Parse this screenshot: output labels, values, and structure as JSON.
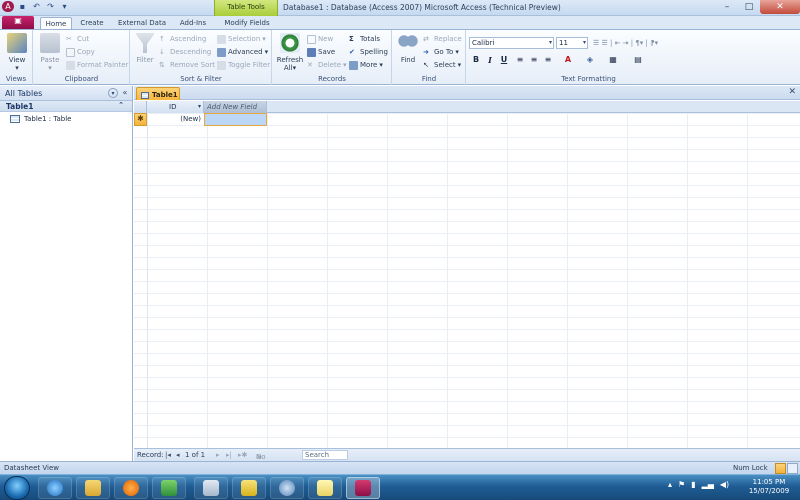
{
  "window": {
    "title": "Database1 : Database (Access 2007)    Microsoft Access (Technical Preview)",
    "context_tab_header": "Table Tools"
  },
  "ribbon_tabs": [
    {
      "label": "Home",
      "active": true
    },
    {
      "label": "Create",
      "active": false
    },
    {
      "label": "External Data",
      "active": false
    },
    {
      "label": "Add-Ins",
      "active": false
    },
    {
      "label": "Modify Fields",
      "active": false
    }
  ],
  "groups": {
    "views": {
      "label": "Views",
      "view_button": "View"
    },
    "clipboard": {
      "label": "Clipboard",
      "paste": "Paste",
      "cut": "Cut",
      "copy": "Copy",
      "format_painter": "Format Painter"
    },
    "sort_filter": {
      "label": "Sort & Filter",
      "filter": "Filter",
      "ascending": "Ascending",
      "descending": "Descending",
      "remove_sort": "Remove Sort",
      "selection": "Selection",
      "advanced": "Advanced",
      "toggle_filter": "Toggle Filter"
    },
    "records": {
      "label": "Records",
      "refresh": "Refresh",
      "refresh_sub": "All",
      "new": "New",
      "save": "Save",
      "delete": "Delete",
      "totals": "Totals",
      "spelling": "Spelling",
      "more": "More"
    },
    "find": {
      "label": "Find",
      "find": "Find",
      "replace": "Replace",
      "go_to": "Go To",
      "select": "Select"
    },
    "text_formatting": {
      "label": "Text Formatting",
      "font": "Calibri",
      "size": "11"
    }
  },
  "nav_pane": {
    "header": "All Tables",
    "group": "Table1",
    "item": "Table1 : Table"
  },
  "document": {
    "tab": "Table1",
    "columns": [
      "ID",
      "Add New Field"
    ],
    "new_row_value": "(New)"
  },
  "record_nav": {
    "record_label": "Record:",
    "position": "1 of 1",
    "filter_status": "No Filter",
    "search_placeholder": "Search"
  },
  "status_bar": {
    "view": "Datasheet View",
    "num_lock": "Num Lock"
  },
  "clock": {
    "time": "11:05 PM",
    "date": "15/07/2009"
  },
  "colors": {
    "accent": "#9f1b4d",
    "context_tab": "#a9cc3a",
    "active_tab_orange": "#f6b53d",
    "taskbar": "#1f5d94"
  }
}
